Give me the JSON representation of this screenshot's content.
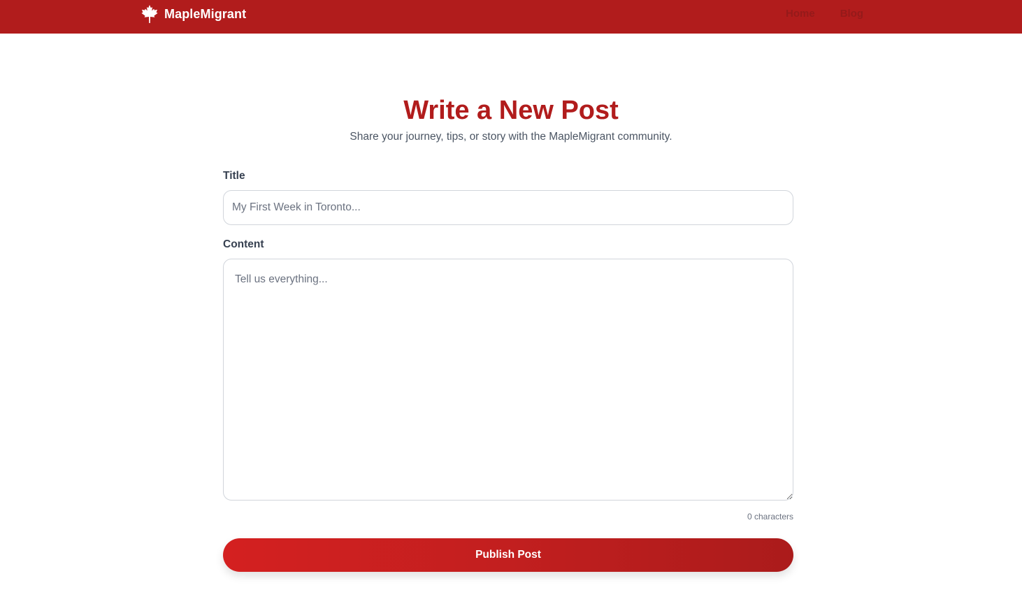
{
  "nav": {
    "brand_name": "MapleMigrant",
    "brand_icon": "maple-leaf-icon",
    "links": [
      {
        "label": "Home"
      },
      {
        "label": "Blog"
      }
    ]
  },
  "header": {
    "title": "Write a New Post",
    "subtitle": "Share your journey, tips, or story with the MapleMigrant community."
  },
  "form": {
    "title_label": "Title",
    "title_placeholder": "My First Week in Toronto...",
    "title_value": "",
    "content_label": "Content",
    "content_placeholder": "Tell us everything...",
    "content_value": "",
    "char_count": "0 characters",
    "submit_label": "Publish Post"
  },
  "colors": {
    "brand_red": "#b11c1c",
    "button_gradient_start": "#d42020",
    "button_gradient_end": "#ab1b1b",
    "text_muted": "#4b5563"
  }
}
